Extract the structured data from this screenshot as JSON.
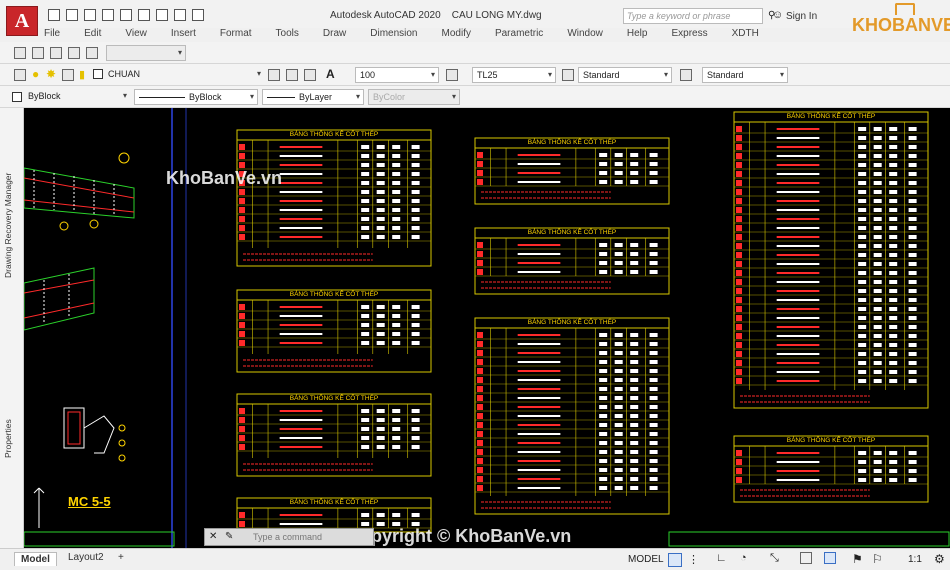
{
  "window": {
    "app_button_letter": "A",
    "title": "Autodesk AutoCAD 2020",
    "filename": "CAU LONG MY.dwg",
    "search_placeholder": "Type a keyword or phrase",
    "sign_in": "Sign In"
  },
  "menus": [
    "File",
    "Edit",
    "View",
    "Insert",
    "Format",
    "Tools",
    "Draw",
    "Dimension",
    "Modify",
    "Parametric",
    "Window",
    "Help",
    "Express",
    "XDTH"
  ],
  "toolbar": {
    "layer_name": "CHUAN",
    "text_height": "100",
    "dim_style": "TL25",
    "table_style": "Standard",
    "multileader_style": "Standard",
    "color": "ByBlock",
    "linetype": "ByBlock",
    "lineweight": "ByLayer",
    "plot_style": "ByColor"
  },
  "side_panels": [
    "Drawing Recovery Manager",
    "Properties"
  ],
  "drawing": {
    "section_label": "MC 5-5",
    "sheet_title": "BẢNG THỐNG KÊ CỐT THÉP",
    "command_prompt": "Type a command"
  },
  "layout_tabs": [
    "Model",
    "Layout2"
  ],
  "status": {
    "model_label": "MODEL",
    "scale": "1:1"
  },
  "watermarks": {
    "logo": "KHOBANVE",
    "site": "KhoBanVe.vn",
    "copyright": "Copyright © KhoBanVe.vn"
  },
  "colors": {
    "app_red": "#c9262a",
    "canvas": "#000000",
    "sheet_frame": "#d8c800",
    "sheet_title": "#ffd400",
    "cad_red": "#ff2a2a",
    "cad_green": "#2bd12b",
    "logo_orange": "#e39a2a"
  }
}
